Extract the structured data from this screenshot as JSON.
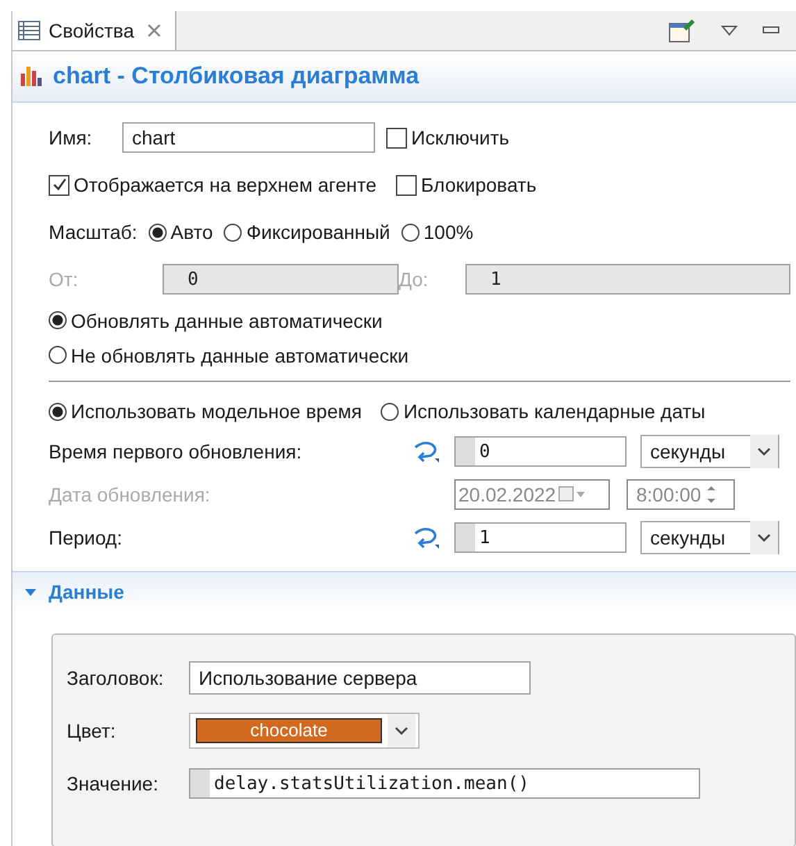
{
  "tab": {
    "label": "Свойства",
    "selected": true
  },
  "title": "chart - Столбиковая диаграмма",
  "name": {
    "label": "Имя:",
    "value": "chart"
  },
  "exclude": {
    "label": "Исключить",
    "checked": false
  },
  "show_on_top": {
    "label": "Отображается на верхнем агенте",
    "checked": true
  },
  "lock": {
    "label": "Блокировать",
    "checked": false
  },
  "scale": {
    "label": "Масштаб:",
    "options": [
      {
        "label": "Авто",
        "selected": true
      },
      {
        "label": "Фиксированный",
        "selected": false
      },
      {
        "label": "100%",
        "selected": false
      }
    ]
  },
  "range": {
    "from_label": "От:",
    "from_value": "0",
    "to_label": "До:",
    "to_value": "1",
    "disabled": true
  },
  "update_mode": [
    {
      "label": "Обновлять данные автоматически",
      "selected": true
    },
    {
      "label": "Не обновлять данные автоматически",
      "selected": false
    }
  ],
  "time_mode": [
    {
      "label": "Использовать модельное время",
      "selected": true
    },
    {
      "label": "Использовать календарные даты",
      "selected": false
    }
  ],
  "first_update": {
    "label": "Время первого обновления:",
    "value": "0",
    "unit": "секунды"
  },
  "update_date": {
    "label": "Дата обновления:",
    "date": "20.02.2022",
    "time": "8:00:00",
    "disabled": true
  },
  "period": {
    "label": "Период:",
    "value": "1",
    "unit": "секунды"
  },
  "data_section": {
    "title": "Данные",
    "expanded": true,
    "heading": {
      "label": "Заголовок:",
      "value": "Использование сервера"
    },
    "color": {
      "label": "Цвет:",
      "value": "chocolate",
      "color": "#d2691e"
    },
    "value": {
      "label": "Значение:",
      "value": "delay.statsUtilization.mean()"
    }
  }
}
